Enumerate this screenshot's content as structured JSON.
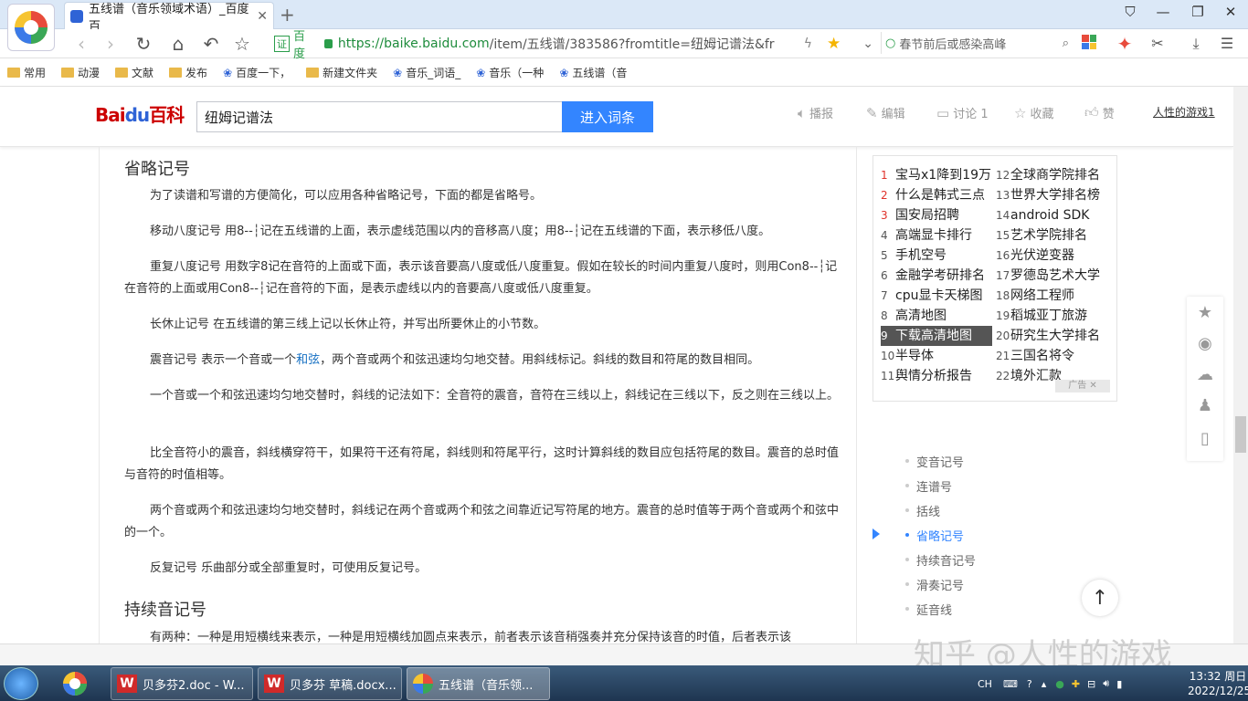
{
  "browser": {
    "tab_title": "五线谱（音乐领域术语）_百度百",
    "url_source": "百度",
    "url_host": "https://baike.baidu.com",
    "url_path": "/item/五线谱/383586?fromtitle=纽姆记谱法&fr",
    "search_placeholder": "春节前后或感染高峰",
    "bookmarks": [
      "常用",
      "动漫",
      "文献",
      "发布",
      "百度一下，",
      "新建文件夹",
      "音乐_词语_",
      "音乐（一种",
      "五线谱（音"
    ]
  },
  "header": {
    "logo_a": "Bai",
    "logo_b": "du",
    "logo_c": "百科",
    "search_value": "纽姆记谱法",
    "search_button": "进入词条",
    "actions": {
      "broadcast": "播报",
      "edit": "编辑",
      "discuss": "讨论 1",
      "collect": "收藏",
      "like": "赞"
    },
    "user": "人性的游戏1"
  },
  "article": {
    "h_abbrev": "省略记号",
    "p1": "为了读谱和写谱的方便简化，可以应用各种省略记号，下面的都是省略号。",
    "p2": "移动八度记号 用8--┆记在五线谱的上面，表示虚线范围以内的音移高八度；用8--┆记在五线谱的下面，表示移低八度。",
    "p3": "重复八度记号 用数字8记在音符的上面或下面，表示该音要高八度或低八度重复。假如在较长的时间内重复八度时，则用Con8--┆记在音符的上面或用Con8--┆记在音符的下面，是表示虚线以内的音要高八度或低八度重复。",
    "p4": "长休止记号 在五线谱的第三线上记以长休止符，并写出所要休止的小节数。",
    "p5_a": "震音记号 表示一个音或一个",
    "p5_link": "和弦",
    "p5_b": "，两个音或两个和弦迅速均匀地交替。用斜线标记。斜线的数目和符尾的数目相同。",
    "p6": "一个音或一个和弦迅速均匀地交替时，斜线的记法如下：全音符的震音，音符在三线以上，斜线记在三线以下，反之则在三线以上。",
    "p7": "比全音符小的震音，斜线横穿符干，如果符干还有符尾，斜线则和符尾平行，这时计算斜线的数目应包括符尾的数目。震音的总时值与音符的时值相等。",
    "p8": "两个音或两个和弦迅速均匀地交替时，斜线记在两个音或两个和弦之间靠近记写符尾的地方。震音的总时值等于两个音或两个和弦中的一个。",
    "p9": "反复记号 乐曲部分或全部重复时，可使用反复记号。",
    "h_sustain": "持续音记号",
    "p10": "有两种：一种是用短横线来表示，一种是用短横线加圆点来表示，前者表示该音稍强奏并充分保持该音的时值，后者表示该"
  },
  "ad": {
    "items": [
      {
        "n": "1",
        "t": "宝马x1降到19万"
      },
      {
        "n": "2",
        "t": "什么是韩式三点"
      },
      {
        "n": "3",
        "t": "国安局招聘"
      },
      {
        "n": "4",
        "t": "高端显卡排行"
      },
      {
        "n": "5",
        "t": "手机空号"
      },
      {
        "n": "6",
        "t": "金融学考研排名"
      },
      {
        "n": "7",
        "t": "cpu显卡天梯图"
      },
      {
        "n": "8",
        "t": "高清地图"
      },
      {
        "n": "9",
        "t": "下载高清地图"
      },
      {
        "n": "10",
        "t": "半导体"
      },
      {
        "n": "11",
        "t": "舆情分析报告"
      },
      {
        "n": "12",
        "t": "全球商学院排名"
      },
      {
        "n": "13",
        "t": "世界大学排名榜"
      },
      {
        "n": "14",
        "t": "android SDK"
      },
      {
        "n": "15",
        "t": "艺术学院排名"
      },
      {
        "n": "16",
        "t": "光伏逆变器"
      },
      {
        "n": "17",
        "t": "罗德岛艺术大学"
      },
      {
        "n": "18",
        "t": "网络工程师"
      },
      {
        "n": "19",
        "t": "稻城亚丁旅游"
      },
      {
        "n": "20",
        "t": "研究生大学排名"
      },
      {
        "n": "21",
        "t": "三国名将令"
      },
      {
        "n": "22",
        "t": "境外汇款"
      }
    ],
    "tag": "广告"
  },
  "toc": [
    "变音记号",
    "连谱号",
    "括线",
    "省略记号",
    "持续音记号",
    "滑奏记号",
    "延音线"
  ],
  "watermark": "知乎 @人性的游戏",
  "taskbar": {
    "items": [
      "贝多芬2.doc - W...",
      "贝多芬 草稿.docx...",
      "五线谱（音乐领..."
    ],
    "lang": "CH",
    "time": "13:32 周日",
    "date": "2022/12/25"
  },
  "colors": {
    "accent": "#3385ff",
    "link": "#136ec2",
    "logo_red": "#cc0000"
  }
}
